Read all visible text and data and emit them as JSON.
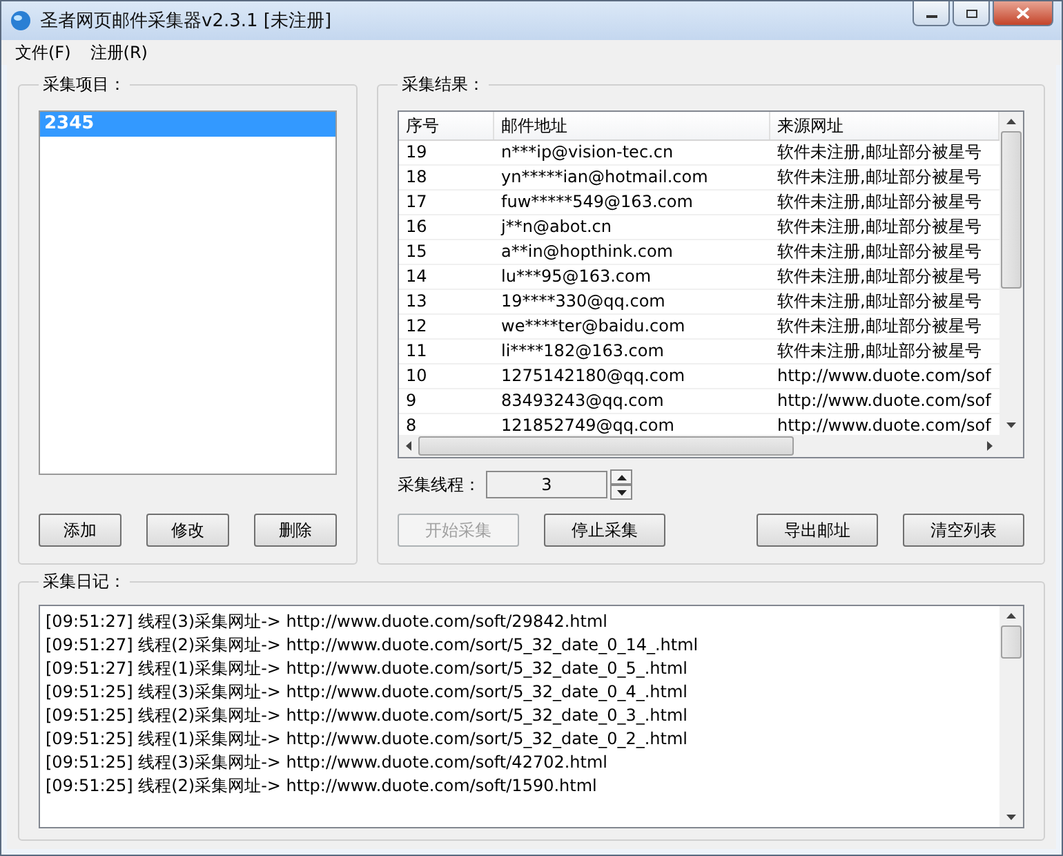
{
  "window": {
    "title": "圣者网页邮件采集器v2.3.1 [未注册]"
  },
  "menu": [
    "文件(F)",
    "注册(R)"
  ],
  "projects": {
    "title": "采集项目：",
    "items": [
      {
        "label": "2345",
        "selected": true
      }
    ],
    "buttons": [
      "添加",
      "修改",
      "删除"
    ]
  },
  "results": {
    "title": "采集结果：",
    "columns": [
      "序号",
      "邮件地址",
      "来源网址"
    ],
    "rows": [
      [
        "19",
        "n***ip@vision-tec.cn",
        "软件未注册,邮址部分被星号"
      ],
      [
        "18",
        "yn*****ian@hotmail.com",
        "软件未注册,邮址部分被星号"
      ],
      [
        "17",
        "fuw*****549@163.com",
        "软件未注册,邮址部分被星号"
      ],
      [
        "16",
        "j**n@abot.cn",
        "软件未注册,邮址部分被星号"
      ],
      [
        "15",
        "a**in@hopthink.com",
        "软件未注册,邮址部分被星号"
      ],
      [
        "14",
        "lu***95@163.com",
        "软件未注册,邮址部分被星号"
      ],
      [
        "13",
        "19****330@qq.com",
        "软件未注册,邮址部分被星号"
      ],
      [
        "12",
        "we****ter@baidu.com",
        "软件未注册,邮址部分被星号"
      ],
      [
        "11",
        "li****182@163.com",
        "软件未注册,邮址部分被星号"
      ],
      [
        "10",
        "1275142180@qq.com",
        "http://www.duote.com/sof"
      ],
      [
        "9",
        "83493243@qq.com",
        "http://www.duote.com/sof"
      ],
      [
        "8",
        "121852749@qq.com",
        "http://www.duote.com/sof"
      ]
    ],
    "threads": {
      "label": "采集线程：",
      "value": "3"
    },
    "buttons": [
      {
        "label": "开始采集",
        "disabled": true
      },
      {
        "label": "停止采集",
        "disabled": false
      },
      {
        "label": "导出邮址",
        "disabled": false
      },
      {
        "label": "清空列表",
        "disabled": false
      }
    ]
  },
  "log": {
    "title": "采集日记：",
    "lines": [
      "[09:51:27] 线程(3)采集网址-> http://www.duote.com/soft/29842.html",
      "[09:51:27] 线程(2)采集网址-> http://www.duote.com/sort/5_32_date_0_14_.html",
      "[09:51:27] 线程(1)采集网址-> http://www.duote.com/sort/5_32_date_0_5_.html",
      "[09:51:25] 线程(3)采集网址-> http://www.duote.com/sort/5_32_date_0_4_.html",
      "[09:51:25] 线程(2)采集网址-> http://www.duote.com/sort/5_32_date_0_3_.html",
      "[09:51:25] 线程(1)采集网址-> http://www.duote.com/sort/5_32_date_0_2_.html",
      "[09:51:25] 线程(3)采集网址-> http://www.duote.com/soft/42702.html",
      "[09:51:25] 线程(2)采集网址-> http://www.duote.com/soft/1590.html"
    ]
  }
}
